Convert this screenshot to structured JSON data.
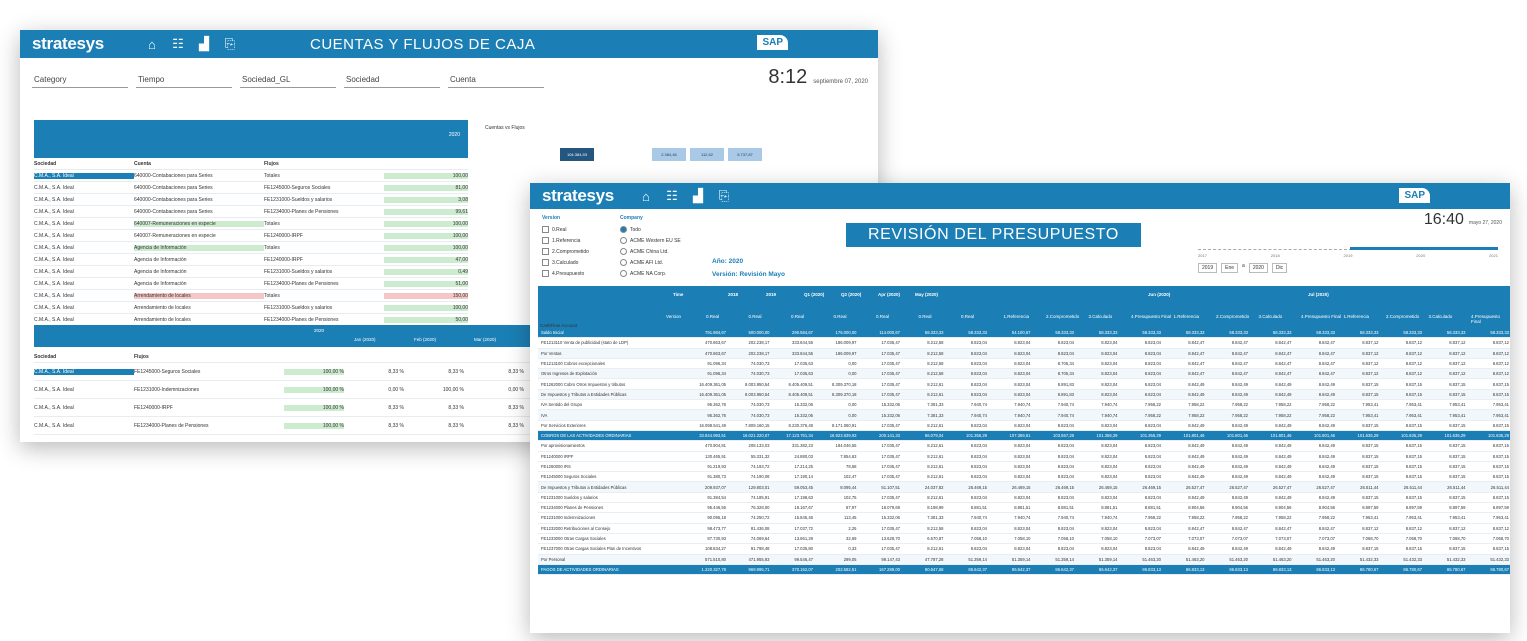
{
  "window1": {
    "logo": "stratesys",
    "title": "CUENTAS Y FLUJOS DE CAJA",
    "sap": "SAP",
    "time": "8:12",
    "date": "septiembre 07, 2020",
    "filters": [
      "Category",
      "Tiempo",
      "Sociedad_GL",
      "Sociedad",
      "Cuenta"
    ],
    "year_label": "2020",
    "right_title": "Cuentas vs Flujos",
    "mini_values": [
      "104.384,93",
      "2.384,46",
      "112,62",
      "5.737,87"
    ],
    "table": {
      "headers": [
        "Sociedad",
        "Cuenta",
        "Flujos"
      ],
      "rows": [
        [
          "C.M.A., S.A. Ideal",
          "640000-Contabaciones para Series",
          "Totales",
          "100,00"
        ],
        [
          "C.M.A., S.A. Ideal",
          "640000-Contabaciones para Series",
          "FE1245000-Seguros Sociales",
          "81,00"
        ],
        [
          "C.M.A., S.A. Ideal",
          "640000-Contabaciones para Series",
          "FE1231000-Sueldos y salarios",
          "3,08"
        ],
        [
          "C.M.A., S.A. Ideal",
          "640000-Contabaciones para Series",
          "FE1234000-Planes de Pensiones",
          "99,61"
        ],
        [
          "C.M.A., S.A. Ideal",
          "640007-Remuneraciones en especie",
          "Totales",
          "100,00"
        ],
        [
          "C.M.A., S.A. Ideal",
          "640007-Remuneraciones en especie",
          "FE1240000-IRPF",
          "100,00"
        ],
        [
          "C.M.A., S.A. Ideal",
          "Agencia de Información",
          "Totales",
          "100,00"
        ],
        [
          "C.M.A., S.A. Ideal",
          "Agencia de Información",
          "FE1240000-IRPF",
          "47,00"
        ],
        [
          "C.M.A., S.A. Ideal",
          "Agencia de Información",
          "FE1231000-Sueldos y salarios",
          "0,49"
        ],
        [
          "C.M.A., S.A. Ideal",
          "Agencia de Información",
          "FE1234000-Planes de Pensiones",
          "51,00"
        ],
        [
          "C.M.A., S.A. Ideal",
          "Arrendamiento de locales",
          "Totales",
          "150,00"
        ],
        [
          "C.M.A., S.A. Ideal",
          "Arrendamiento de locales",
          "FE1231000-Sueldos y salarios",
          "100,00"
        ],
        [
          "C.M.A., S.A. Ideal",
          "Arrendamiento de locales",
          "FE1234000-Planes de Pensiones",
          "50,00"
        ]
      ]
    },
    "table2": {
      "year": "2020",
      "months": [
        "Jan (2020)",
        "Feb (2020)",
        "Mar (2020)"
      ],
      "headers": [
        "Sociedad",
        "Flujos"
      ],
      "rows": [
        [
          "C.M.A., S.A. Ideal",
          "FE1245000-Seguros Sociales",
          "100,00 %",
          "8,33 %",
          "8,33 %",
          "8,33 %"
        ],
        [
          "C.M.A., S.A. Ideal",
          "FE1231000-Indemnizaciones",
          "100,00 %",
          "0,00 %",
          "100,00 %",
          "0,00 %"
        ],
        [
          "C.M.A., S.A. Ideal",
          "FE1240000-IRPF",
          "100,00 %",
          "8,33 %",
          "8,33 %",
          "8,33 %"
        ],
        [
          "C.M.A., S.A. Ideal",
          "FE1234000-Planes de Pensiones",
          "100,00 %",
          "8,33 %",
          "8,33 %",
          "8,33 %"
        ]
      ]
    }
  },
  "window2": {
    "logo": "stratesys",
    "title": "REVISIÓN DEL PRESUPUESTO",
    "sap": "SAP",
    "time": "16:40",
    "date": "mayo 27, 2020",
    "version_header": "Version",
    "versions": [
      "0.Real",
      "1.Referencia",
      "2.Comprometido",
      "3.Calculado",
      "4.Presupuesto"
    ],
    "company_header": "Company",
    "companies": [
      "Todo",
      "ACME Western EU SE",
      "ACME China Ltd.",
      "ACME AFI Ltd.",
      "ACME NA Corp."
    ],
    "ano": "Año: 2020",
    "version_label": "Versión: Revisión Mayo",
    "timeline_labels": [
      "2017",
      "2018",
      "2019",
      "2020",
      "2021"
    ],
    "date_range": [
      "2019",
      "Ene",
      "a",
      "2020",
      "Dic"
    ],
    "table_head": {
      "time_label": "Time",
      "version_label": "Version",
      "cashflow_label": "CashFlow Account",
      "periods": [
        "2018",
        "2019",
        "Q1 (2020)",
        "Q2 (2020)",
        "Apr (2020)",
        "May (2020)",
        "Jun (2020)",
        "Jul (2020)"
      ],
      "versions": [
        "0.Real",
        "0.Real",
        "0.Real",
        "0.Real",
        "0.Real",
        "0.Real",
        "0.Real",
        "1.Referencia",
        "2.Comprometido",
        "3.Calculado",
        "4.Presupuesto Final",
        "1.Referencia",
        "2.Comprometido",
        "3.Calculado",
        "4.Presupuesto Final",
        "1.Referencia",
        "2.Comprometido",
        "3.Calculado",
        "4.Presupuesto Final"
      ]
    },
    "rows": [
      {
        "label": "Saldo Inicial",
        "type": "group",
        "values": [
          "791.984,67",
          "500.000,00",
          "290.584,67",
          "175.000,00",
          "114.000,67",
          "58.333,33",
          "58.333,33",
          "54.100,67",
          "58.333,33",
          "58.333,33",
          "58.333,33",
          "58.333,33",
          "58.333,33",
          "58.333,33",
          "58.333,33",
          "58.333,33",
          "58.333,33",
          "58.333,33",
          "58.333,33"
        ]
      },
      {
        "label": "FE1213110 Venta de publicidad (stato de LDP)",
        "type": "row",
        "values": [
          "470.863,67",
          "202.238,17",
          "333.844,55",
          "186.009,97",
          "17.035,47",
          "8.212,58",
          "8.823,04",
          "8.823,04",
          "8.823,04",
          "8.823,04",
          "8.823,04",
          "8.842,47",
          "8.842,47",
          "8.842,47",
          "8.842,47",
          "8.837,12",
          "8.837,12",
          "8.837,12",
          "8.837,12"
        ]
      },
      {
        "label": "Por Ventas",
        "type": "sub",
        "values": [
          "470.863,67",
          "202.238,17",
          "333.844,55",
          "186.009,97",
          "17.035,47",
          "8.212,58",
          "8.823,04",
          "8.823,04",
          "8.823,04",
          "8.823,04",
          "8.823,04",
          "8.842,47",
          "8.842,47",
          "8.842,47",
          "8.842,47",
          "8.837,12",
          "8.837,12",
          "8.837,12",
          "8.837,12"
        ]
      },
      {
        "label": "FE1213100 Cobros excepcionales",
        "type": "row",
        "values": [
          "91.096,34",
          "74.030,73",
          "17.035,63",
          "0,00",
          "17.035,47",
          "8.212,58",
          "8.823,04",
          "8.823,04",
          "8.705,34",
          "8.823,04",
          "8.823,04",
          "8.842,47",
          "8.842,47",
          "8.842,47",
          "8.842,47",
          "8.837,12",
          "8.837,12",
          "8.837,12",
          "8.837,12"
        ]
      },
      {
        "label": "Otros Ingresos de Explotación",
        "type": "sub",
        "values": [
          "91.096,34",
          "74.030,73",
          "17.035,63",
          "0,00",
          "17.035,47",
          "8.212,58",
          "8.823,04",
          "8.823,04",
          "8.705,34",
          "8.823,04",
          "8.823,04",
          "8.842,47",
          "8.842,47",
          "8.842,47",
          "8.842,47",
          "8.837,12",
          "8.837,12",
          "8.837,12",
          "8.837,12"
        ]
      },
      {
        "label": "FE1262000 Cobro Otros Impuestos y tributos",
        "type": "row",
        "values": [
          "16.409.361,05",
          "8.003.950,54",
          "8.405.409,51",
          "8.309.370,18",
          "17.035,47",
          "8.212,61",
          "8.823,04",
          "8.823,04",
          "8.891,83",
          "8.823,04",
          "8.823,04",
          "8.842,49",
          "8.842,49",
          "8.842,49",
          "8.842,49",
          "8.837,15",
          "8.837,15",
          "8.837,15",
          "8.837,15"
        ]
      },
      {
        "label": "De Impuestos y Tributos a Entidades Públicas",
        "type": "sub",
        "values": [
          "16.409.361,05",
          "8.003.950,54",
          "8.405.409,51",
          "8.309.370,18",
          "17.035,47",
          "8.212,61",
          "8.823,04",
          "8.823,04",
          "8.891,83",
          "8.823,04",
          "8.823,04",
          "8.842,49",
          "8.842,49",
          "8.842,49",
          "8.842,49",
          "8.837,15",
          "8.837,15",
          "8.837,15",
          "8.837,15"
        ]
      },
      {
        "label": "IVA Sentido del Grupo",
        "type": "row",
        "values": [
          "95.362,76",
          "74.030,73",
          "15.332,06",
          "0,00",
          "15.332,06",
          "7.381,33",
          "7.940,74",
          "7.940,74",
          "7.940,74",
          "7.940,74",
          "7.958,22",
          "7.958,22",
          "7.958,22",
          "7.958,22",
          "7.958,22",
          "7.953,41",
          "7.953,41",
          "7.953,41",
          "7.953,41"
        ]
      },
      {
        "label": "IVA",
        "type": "sub",
        "values": [
          "95.362,76",
          "74.030,73",
          "15.332,06",
          "0,00",
          "15.332,06",
          "7.381,33",
          "7.940,74",
          "7.940,74",
          "7.940,74",
          "7.940,74",
          "7.958,22",
          "7.958,22",
          "7.958,22",
          "7.958,22",
          "7.958,22",
          "7.953,41",
          "7.953,41",
          "7.953,41",
          "7.953,41"
        ]
      },
      {
        "label": "Por Servicios Exteriores",
        "type": "row",
        "values": [
          "16.098.541,49",
          "7.809.160,15",
          "8.230.376,48",
          "8.171.060,91",
          "17.035,47",
          "8.212,61",
          "8.823,04",
          "8.823,04",
          "8.823,04",
          "8.823,04",
          "8.823,04",
          "8.842,49",
          "8.842,49",
          "8.842,49",
          "8.842,49",
          "8.837,15",
          "8.837,15",
          "8.837,15",
          "8.837,15"
        ]
      },
      {
        "label": "COBROS DE LAS ACTIVIDADES ORDINARIAS",
        "type": "group",
        "values": [
          "33.844.993,51",
          "16.021.220,67",
          "17.123.761,34",
          "16.923.639,93",
          "200.141,33",
          "86.079,04",
          "101.356,29",
          "107.389,61",
          "103.557,28",
          "101.356,29",
          "101.356,29",
          "101.801,46",
          "101.801,46",
          "101.801,46",
          "101.801,46",
          "101.635,29",
          "101.635,29",
          "101.635,29",
          "101.635,29"
        ]
      },
      {
        "label": "Por aprovisionamientos",
        "type": "row",
        "values": [
          "470.904,81",
          "208.133,03",
          "331.382,23",
          "184.046,55",
          "17.035,47",
          "8.212,61",
          "8.823,04",
          "8.823,04",
          "8.823,04",
          "8.823,04",
          "8.823,04",
          "8.842,49",
          "8.842,49",
          "8.842,49",
          "8.842,49",
          "8.837,15",
          "8.837,15",
          "8.837,15",
          "8.837,15"
        ]
      },
      {
        "label": "FE1240000 IRPF",
        "type": "row",
        "values": [
          "130.465,91",
          "55.331,32",
          "24.880,03",
          "7.854,63",
          "17.035,47",
          "8.212,61",
          "8.823,04",
          "8.823,04",
          "8.823,04",
          "8.823,04",
          "8.823,04",
          "8.842,49",
          "8.842,49",
          "8.842,49",
          "8.842,49",
          "8.837,15",
          "8.837,15",
          "8.837,15",
          "8.837,15"
        ]
      },
      {
        "label": "FE1260000 IRS",
        "type": "row",
        "values": [
          "91.219,93",
          "74.193,72",
          "17.214,25",
          "78,58",
          "17.035,47",
          "8.212,61",
          "8.823,04",
          "8.823,04",
          "8.823,04",
          "8.823,04",
          "8.823,04",
          "8.842,49",
          "8.842,49",
          "8.842,49",
          "8.842,49",
          "8.837,15",
          "8.837,15",
          "8.837,15",
          "8.837,15"
        ]
      },
      {
        "label": "FE1245000 Seguros Sociales",
        "type": "row",
        "values": [
          "91.380,73",
          "74.190,08",
          "17.190,14",
          "102,47",
          "17.035,47",
          "8.212,61",
          "8.823,04",
          "8.823,04",
          "8.823,04",
          "8.823,04",
          "8.823,04",
          "8.842,49",
          "8.842,49",
          "8.842,49",
          "8.842,49",
          "8.837,15",
          "8.837,15",
          "8.837,15",
          "8.837,15"
        ]
      },
      {
        "label": "De Impuestos y Tributos a Entidades Públicas",
        "type": "sub",
        "values": [
          "209.937,07",
          "129.803,01",
          "59.053,45",
          "8.095,44",
          "51.107,51",
          "24.037,82",
          "26.469,15",
          "26.469,15",
          "26.469,15",
          "26.469,15",
          "26.469,15",
          "26.527,47",
          "26.527,47",
          "26.527,47",
          "26.527,47",
          "26.511,44",
          "26.511,44",
          "26.511,44",
          "26.511,44"
        ]
      },
      {
        "label": "FE1231000 Sueldos y salarios",
        "type": "row",
        "values": [
          "91.384,54",
          "74.185,91",
          "17.198,63",
          "102,75",
          "17.035,47",
          "8.212,61",
          "8.823,04",
          "8.823,04",
          "8.823,04",
          "8.823,04",
          "8.823,04",
          "8.842,49",
          "8.842,49",
          "8.842,49",
          "8.842,49",
          "8.837,15",
          "8.837,15",
          "8.837,15",
          "8.837,15"
        ]
      },
      {
        "label": "FE1234000 Planes de Pensiones",
        "type": "row",
        "values": [
          "95.446,55",
          "76.328,00",
          "19.167,67",
          "87,97",
          "18.079,69",
          "8.198,99",
          "8.881,51",
          "8.881,51",
          "8.881,51",
          "8.881,51",
          "8.881,51",
          "8.904,56",
          "8.904,56",
          "8.904,56",
          "8.904,56",
          "8.897,59",
          "8.897,59",
          "8.897,59",
          "8.897,59"
        ]
      },
      {
        "label": "FE1231000 Indemnizaciones",
        "type": "row",
        "values": [
          "90.095,18",
          "74.250,72",
          "15.845,46",
          "113,45",
          "15.332,06",
          "7.381,33",
          "7.940,74",
          "7.940,74",
          "7.940,74",
          "7.940,74",
          "7.958,22",
          "7.958,22",
          "7.958,22",
          "7.958,22",
          "7.958,22",
          "7.953,41",
          "7.953,41",
          "7.953,41",
          "7.953,41"
        ]
      },
      {
        "label": "FE1232000 Retribuciones al Consejo",
        "type": "row",
        "values": [
          "98.473,77",
          "81.436,08",
          "17.037,72",
          "2,25",
          "17.035,47",
          "8.212,58",
          "8.823,04",
          "8.823,04",
          "8.823,04",
          "8.823,04",
          "8.823,04",
          "8.842,47",
          "8.842,47",
          "8.842,47",
          "8.842,47",
          "8.837,12",
          "8.837,12",
          "8.837,12",
          "8.837,12"
        ]
      },
      {
        "label": "FE1233000 Otras Cargas Sociales",
        "type": "row",
        "values": [
          "87.730,93",
          "74.069,64",
          "13.661,29",
          "32,69",
          "13.628,70",
          "6.570,87",
          "7.058,10",
          "7.058,10",
          "7.058,10",
          "7.058,10",
          "7.073,07",
          "7.073,07",
          "7.073,07",
          "7.073,07",
          "7.073,07",
          "7.068,70",
          "7.068,70",
          "7.068,70",
          "7.068,70"
        ]
      },
      {
        "label": "FE1237000 Otras Cargas Sociales Plan de Incentivos",
        "type": "row",
        "values": [
          "108.834,27",
          "91.798,48",
          "17.035,80",
          "0,33",
          "17.035,47",
          "8.212,61",
          "8.823,04",
          "8.823,04",
          "8.823,04",
          "8.823,04",
          "8.823,04",
          "8.842,49",
          "8.842,49",
          "8.842,49",
          "8.842,49",
          "8.837,15",
          "8.837,15",
          "8.837,15",
          "8.837,15"
        ]
      },
      {
        "label": "Por Personal",
        "type": "sub",
        "values": [
          "571.510,80",
          "471.955,93",
          "99.546,47",
          "299,05",
          "99.147,43",
          "47.787,28",
          "51.359,14",
          "51.359,14",
          "51.359,14",
          "51.359,14",
          "51.463,20",
          "51.463,20",
          "51.463,20",
          "51.463,20",
          "51.463,20",
          "51.432,33",
          "51.432,33",
          "51.432,33",
          "51.432,33"
        ]
      },
      {
        "label": "PAGOS DE ACTIVIDADES ORDINARIAS",
        "type": "group",
        "values": [
          "1.220.327,78",
          "969.995,71",
          "370.152,07",
          "202.582,51",
          "167.289,00",
          "80.647,68",
          "86.642,37",
          "86.642,37",
          "86.642,37",
          "86.642,37",
          "86.833,13",
          "86.833,13",
          "86.833,13",
          "86.833,13",
          "86.833,13",
          "86.780,67",
          "86.780,67",
          "86.780,67",
          "86.780,67"
        ]
      }
    ]
  },
  "colors": {
    "brand": "#1b7fb5",
    "selected": "#1b7fb5",
    "positive": "#cdeccf",
    "negative": "#f5c6c6"
  }
}
